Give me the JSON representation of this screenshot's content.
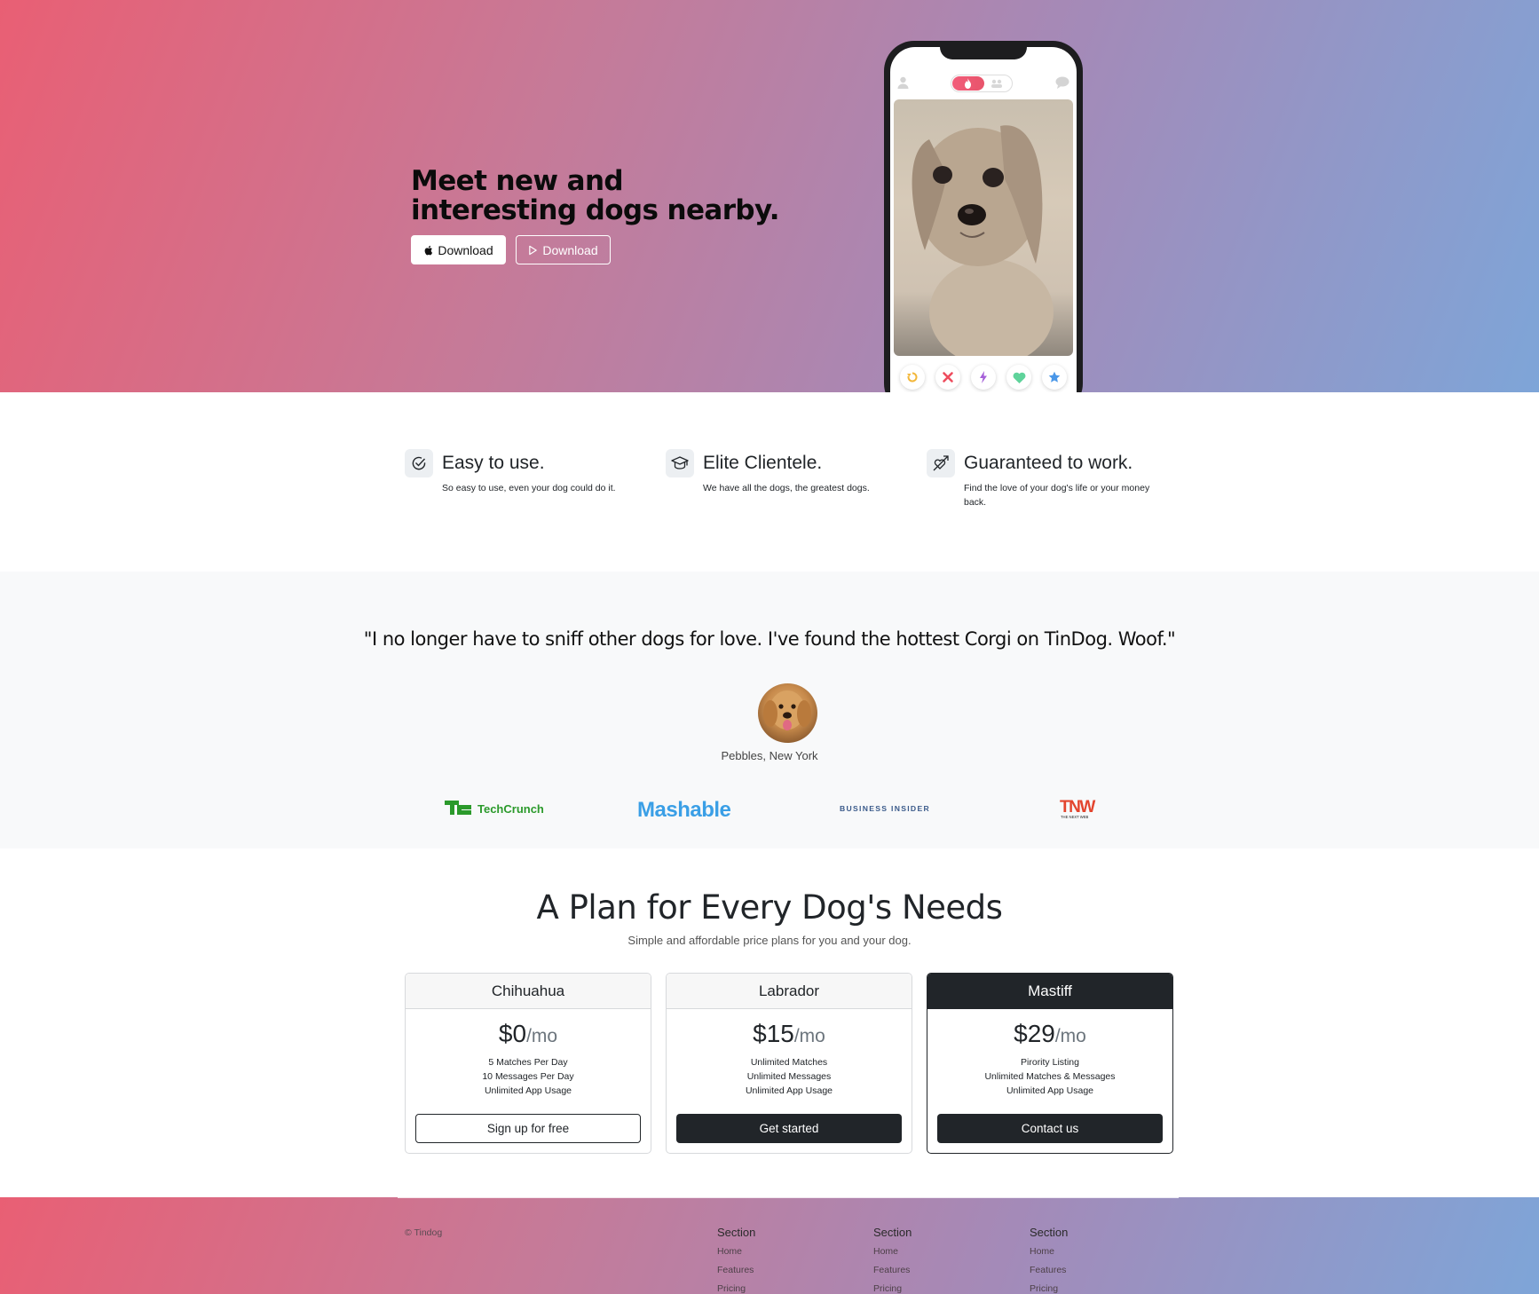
{
  "hero": {
    "headline": "Meet new and interesting dogs nearby.",
    "apple_download_label": "Download",
    "play_download_label": "Download"
  },
  "features": [
    {
      "icon": "check-circle-icon",
      "title": "Easy to use.",
      "text": "So easy to use, even your dog could do it."
    },
    {
      "icon": "graduation-cap-icon",
      "title": "Elite Clientele.",
      "text": "We have all the dogs, the greatest dogs."
    },
    {
      "icon": "heart-arrow-icon",
      "title": "Guaranteed to work.",
      "text": "Find the love of your dog's life or your money back."
    }
  ],
  "testimonial": {
    "quote": "\"I no longer have to sniff other dogs for love. I've found the hottest Corgi on TinDog. Woof.\"",
    "author": "Pebbles, New York"
  },
  "press": [
    {
      "name": "TechCrunch",
      "mark": "TC",
      "color": "#2b9a2b"
    },
    {
      "name": "Mashable",
      "color": "#3a9fe6"
    },
    {
      "name": "BUSINESS INSIDER",
      "color": "#3a5a8a"
    },
    {
      "name": "TNW",
      "sub": "THE NEXT WEB",
      "color": "#e3452e"
    }
  ],
  "pricing": {
    "title": "A Plan for Every Dog's Needs",
    "subtitle": "Simple and affordable price plans for you and your dog.",
    "plans": [
      {
        "name": "Chihuahua",
        "price": "$0",
        "per": "/mo",
        "perks": [
          "5 Matches Per Day",
          "10 Messages Per Day",
          "Unlimited App Usage"
        ],
        "button": "Sign up for free"
      },
      {
        "name": "Labrador",
        "price": "$15",
        "per": "/mo",
        "perks": [
          "Unlimited Matches",
          "Unlimited Messages",
          "Unlimited App Usage"
        ],
        "button": "Get started"
      },
      {
        "name": "Mastiff",
        "price": "$29",
        "per": "/mo",
        "perks": [
          "Pirority Listing",
          "Unlimited Matches & Messages",
          "Unlimited App Usage"
        ],
        "button": "Contact us"
      }
    ]
  },
  "footer": {
    "copyright": "© Tindog",
    "columns": [
      {
        "title": "Section",
        "links": [
          "Home",
          "Features",
          "Pricing"
        ]
      },
      {
        "title": "Section",
        "links": [
          "Home",
          "Features",
          "Pricing"
        ]
      },
      {
        "title": "Section",
        "links": [
          "Home",
          "Features",
          "Pricing"
        ]
      }
    ]
  },
  "colors": {
    "gradient_start": "#e95f74",
    "gradient_end": "#7ea5d8",
    "dark": "#212529"
  }
}
